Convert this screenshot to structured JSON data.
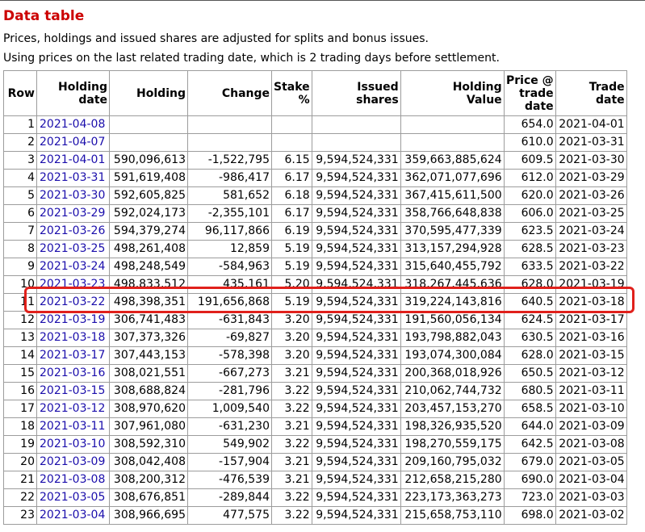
{
  "page": {
    "title": "Data table",
    "note1": "Prices, holdings and issued shares are adjusted for splits and bonus issues.",
    "note2": "Using prices on the last related trading date, which is 2 trading days before settlement."
  },
  "table": {
    "headers": [
      "Row",
      "Holding date",
      "Holding",
      "Change",
      "Stake %",
      "Issued shares",
      "Holding Value",
      "Price @ trade date",
      "Trade date"
    ],
    "rows": [
      [
        "1",
        "2021-04-08",
        "",
        "",
        "",
        "",
        "",
        "654.0",
        "2021-04-01"
      ],
      [
        "2",
        "2021-04-07",
        "",
        "",
        "",
        "",
        "",
        "610.0",
        "2021-03-31"
      ],
      [
        "3",
        "2021-04-01",
        "590,096,613",
        "-1,522,795",
        "6.15",
        "9,594,524,331",
        "359,663,885,624",
        "609.5",
        "2021-03-30"
      ],
      [
        "4",
        "2021-03-31",
        "591,619,408",
        "-986,417",
        "6.17",
        "9,594,524,331",
        "362,071,077,696",
        "612.0",
        "2021-03-29"
      ],
      [
        "5",
        "2021-03-30",
        "592,605,825",
        "581,652",
        "6.18",
        "9,594,524,331",
        "367,415,611,500",
        "620.0",
        "2021-03-26"
      ],
      [
        "6",
        "2021-03-29",
        "592,024,173",
        "-2,355,101",
        "6.17",
        "9,594,524,331",
        "358,766,648,838",
        "606.0",
        "2021-03-25"
      ],
      [
        "7",
        "2021-03-26",
        "594,379,274",
        "96,117,866",
        "6.19",
        "9,594,524,331",
        "370,595,477,339",
        "623.5",
        "2021-03-24"
      ],
      [
        "8",
        "2021-03-25",
        "498,261,408",
        "12,859",
        "5.19",
        "9,594,524,331",
        "313,157,294,928",
        "628.5",
        "2021-03-23"
      ],
      [
        "9",
        "2021-03-24",
        "498,248,549",
        "-584,963",
        "5.19",
        "9,594,524,331",
        "315,640,455,792",
        "633.5",
        "2021-03-22"
      ],
      [
        "10",
        "2021-03-23",
        "498,833,512",
        "435,161",
        "5.20",
        "9,594,524,331",
        "318,267,445,636",
        "628.0",
        "2021-03-19"
      ],
      [
        "11",
        "2021-03-22",
        "498,398,351",
        "191,656,868",
        "5.19",
        "9,594,524,331",
        "319,224,143,816",
        "640.5",
        "2021-03-18"
      ],
      [
        "12",
        "2021-03-19",
        "306,741,483",
        "-631,843",
        "3.20",
        "9,594,524,331",
        "191,560,056,134",
        "624.5",
        "2021-03-17"
      ],
      [
        "13",
        "2021-03-18",
        "307,373,326",
        "-69,827",
        "3.20",
        "9,594,524,331",
        "193,798,882,043",
        "630.5",
        "2021-03-16"
      ],
      [
        "14",
        "2021-03-17",
        "307,443,153",
        "-578,398",
        "3.20",
        "9,594,524,331",
        "193,074,300,084",
        "628.0",
        "2021-03-15"
      ],
      [
        "15",
        "2021-03-16",
        "308,021,551",
        "-667,273",
        "3.21",
        "9,594,524,331",
        "200,368,018,926",
        "650.5",
        "2021-03-12"
      ],
      [
        "16",
        "2021-03-15",
        "308,688,824",
        "-281,796",
        "3.22",
        "9,594,524,331",
        "210,062,744,732",
        "680.5",
        "2021-03-11"
      ],
      [
        "17",
        "2021-03-12",
        "308,970,620",
        "1,009,540",
        "3.22",
        "9,594,524,331",
        "203,457,153,270",
        "658.5",
        "2021-03-10"
      ],
      [
        "18",
        "2021-03-11",
        "307,961,080",
        "-631,230",
        "3.21",
        "9,594,524,331",
        "198,326,935,520",
        "644.0",
        "2021-03-09"
      ],
      [
        "19",
        "2021-03-10",
        "308,592,310",
        "549,902",
        "3.22",
        "9,594,524,331",
        "198,270,559,175",
        "642.5",
        "2021-03-08"
      ],
      [
        "20",
        "2021-03-09",
        "308,042,408",
        "-157,904",
        "3.21",
        "9,594,524,331",
        "209,160,795,032",
        "679.0",
        "2021-03-05"
      ],
      [
        "21",
        "2021-03-08",
        "308,200,312",
        "-476,539",
        "3.21",
        "9,594,524,331",
        "212,658,215,280",
        "690.0",
        "2021-03-04"
      ],
      [
        "22",
        "2021-03-05",
        "308,676,851",
        "-289,844",
        "3.22",
        "9,594,524,331",
        "223,173,363,273",
        "723.0",
        "2021-03-03"
      ],
      [
        "23",
        "2021-03-04",
        "308,966,695",
        "477,575",
        "3.22",
        "9,594,524,331",
        "215,658,753,110",
        "698.0",
        "2021-03-02"
      ]
    ]
  },
  "highlight": {
    "row": "11",
    "color": "#e0201b"
  },
  "colors": {
    "title": "#cc0000",
    "link": "#1a0dab",
    "border": "#9c9c9c"
  }
}
